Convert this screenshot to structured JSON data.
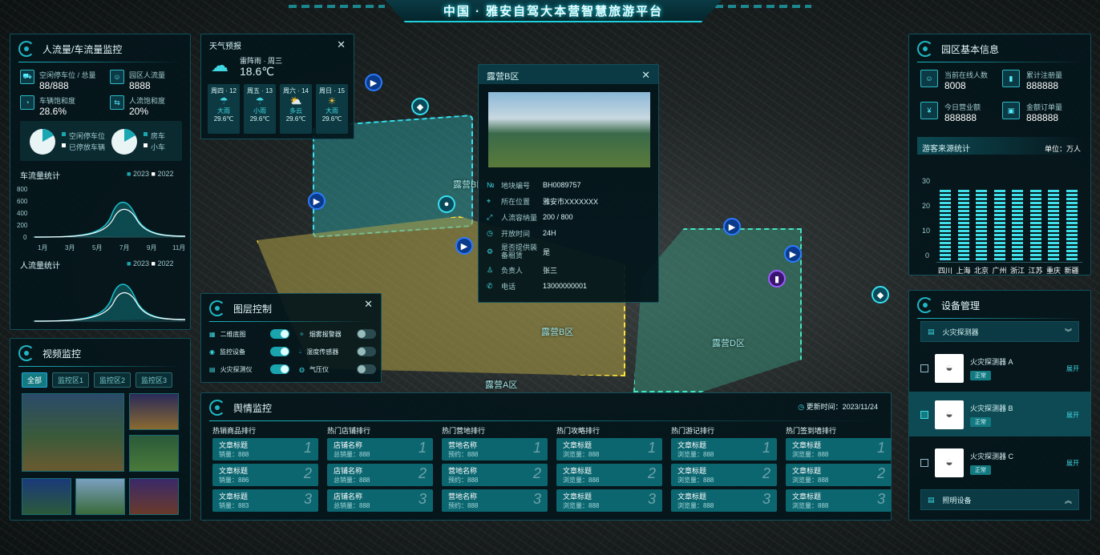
{
  "header": {
    "title": "中国 · 雅安自驾大本营智慧旅游平台"
  },
  "map": {
    "zones": [
      "露营B区",
      "露营A区",
      "露营B区",
      "露营D区"
    ]
  },
  "flow": {
    "title": "人流量/车流量监控",
    "stats": [
      {
        "label": "空闲停车位 / 总量",
        "value": "88/888"
      },
      {
        "label": "园区人流量",
        "value": "8888"
      },
      {
        "label": "车辆饱和度",
        "value": "28.6%"
      },
      {
        "label": "人流饱和度",
        "value": "20%"
      }
    ],
    "pie1": {
      "legend": [
        "空闲停车位",
        "已停放车辆"
      ]
    },
    "pie2": {
      "legend": [
        "房车",
        "小车"
      ]
    },
    "car_title": "车流量统计",
    "people_title": "人流量统计",
    "legend": [
      "2023",
      "2022"
    ],
    "yticks": [
      "800",
      "600",
      "400",
      "200",
      "0"
    ],
    "xticks": [
      "1月",
      "3月",
      "5月",
      "7月",
      "9月",
      "11月"
    ]
  },
  "weather": {
    "title": "天气预报",
    "today": "雷阵雨 · 周三",
    "temp": "18.6℃",
    "days": [
      {
        "day": "周四 · 12",
        "desc": "大雨",
        "temp": "29.6℃"
      },
      {
        "day": "周五 · 13",
        "desc": "小雨",
        "temp": "29.6℃"
      },
      {
        "day": "周六 · 14",
        "desc": "多云",
        "temp": "29.6℃"
      },
      {
        "day": "周日 · 15",
        "desc": "大雨",
        "temp": "29.6℃"
      }
    ]
  },
  "popup": {
    "title": "露营B区",
    "fields": [
      {
        "k": "地块编号",
        "v": "BH0089757"
      },
      {
        "k": "所在位置",
        "v": "雅安市XXXXXXX"
      },
      {
        "k": "人流容纳量",
        "v": "200 / 800"
      },
      {
        "k": "开放时间",
        "v": "24H"
      },
      {
        "k": "是否提供装备租赁",
        "v": "是"
      },
      {
        "k": "负责人",
        "v": "张三"
      },
      {
        "k": "电话",
        "v": "13000000001"
      }
    ]
  },
  "layers": {
    "title": "图层控制",
    "items": [
      {
        "label": "二维底图",
        "on": true
      },
      {
        "label": "烟雾报警器",
        "on": false
      },
      {
        "label": "监控设备",
        "on": true
      },
      {
        "label": "湿度传感器",
        "on": false
      },
      {
        "label": "火灾探测仪",
        "on": true
      },
      {
        "label": "气压仪",
        "on": false
      }
    ]
  },
  "video": {
    "title": "视频监控",
    "tabs": [
      "全部",
      "监控区1",
      "监控区2",
      "监控区3"
    ]
  },
  "opinion": {
    "title": "舆情监控",
    "updated": "更新时间：2023/11/24",
    "columns": [
      {
        "title": "热销商品排行",
        "items": [
          {
            "t": "文章标题",
            "s": "销量：888",
            "n": "1"
          },
          {
            "t": "文章标题",
            "s": "销量：886",
            "n": "2"
          },
          {
            "t": "文章标题",
            "s": "销量：883",
            "n": "3"
          }
        ]
      },
      {
        "title": "热门店铺排行",
        "items": [
          {
            "t": "店铺名称",
            "s": "总销量：888",
            "n": "1"
          },
          {
            "t": "店铺名称",
            "s": "总销量：888",
            "n": "2"
          },
          {
            "t": "店铺名称",
            "s": "总销量：888",
            "n": "3"
          }
        ]
      },
      {
        "title": "热门营地排行",
        "items": [
          {
            "t": "营地名称",
            "s": "预约：888",
            "n": "1"
          },
          {
            "t": "营地名称",
            "s": "预约：888",
            "n": "2"
          },
          {
            "t": "营地名称",
            "s": "预约：888",
            "n": "3"
          }
        ]
      },
      {
        "title": "热门攻略排行",
        "items": [
          {
            "t": "文章标题",
            "s": "浏览量：888",
            "n": "1"
          },
          {
            "t": "文章标题",
            "s": "浏览量：888",
            "n": "2"
          },
          {
            "t": "文章标题",
            "s": "浏览量：888",
            "n": "3"
          }
        ]
      },
      {
        "title": "热门游记排行",
        "items": [
          {
            "t": "文章标题",
            "s": "浏览量：888",
            "n": "1"
          },
          {
            "t": "文章标题",
            "s": "浏览量：888",
            "n": "2"
          },
          {
            "t": "文章标题",
            "s": "浏览量：888",
            "n": "3"
          }
        ]
      },
      {
        "title": "热门签到墙排行",
        "items": [
          {
            "t": "文章标题",
            "s": "浏览量：888",
            "n": "1"
          },
          {
            "t": "文章标题",
            "s": "浏览量：888",
            "n": "2"
          },
          {
            "t": "文章标题",
            "s": "浏览量：888",
            "n": "3"
          }
        ]
      }
    ]
  },
  "park": {
    "title": "园区基本信息",
    "stats": [
      {
        "label": "当前在线人数",
        "value": "8008"
      },
      {
        "label": "累计注册量",
        "value": "888888"
      },
      {
        "label": "今日营业额",
        "value": "888888"
      },
      {
        "label": "金额订单量",
        "value": "888888"
      }
    ],
    "source_title": "游客来源统计",
    "unit": "单位：万人",
    "yticks": [
      "30",
      "20",
      "10",
      "0"
    ]
  },
  "chart_data": {
    "type": "bar",
    "categories": [
      "四川",
      "上海",
      "北京",
      "广州",
      "浙江",
      "江苏",
      "重庆",
      "新疆"
    ],
    "values": [
      28,
      28,
      28,
      28,
      28,
      28,
      28,
      28
    ],
    "ylim": [
      0,
      30
    ]
  },
  "devices": {
    "title": "设备管理",
    "group1": "火灾探测器",
    "group2": "照明设备",
    "expand": "展开",
    "items": [
      {
        "name": "火灾探测器 A",
        "status": "正常"
      },
      {
        "name": "火灾探测器 B",
        "status": "正常"
      },
      {
        "name": "火灾探测器 C",
        "status": "正常"
      }
    ]
  }
}
